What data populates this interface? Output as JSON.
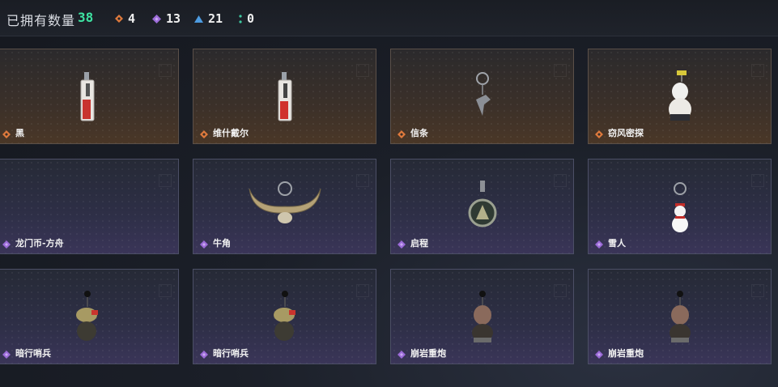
{
  "header": {
    "owned_label": "已拥有数量",
    "owned_count": "38",
    "stats": [
      {
        "icon": "orange-diamond-icon",
        "color": "#e07a3c",
        "value": "4"
      },
      {
        "icon": "purple-diamond-icon",
        "color": "#9c6bd8",
        "value": "13"
      },
      {
        "icon": "blue-triangle-icon",
        "color": "#4d9be0",
        "value": "21"
      },
      {
        "icon": "green-dots-icon",
        "color": "#3ec9a0",
        "value": "0"
      }
    ]
  },
  "colors": {
    "orange": "#e07a3c",
    "purple": "#9c6bd8"
  },
  "items": [
    {
      "name": "黑",
      "rarity": "orange",
      "icon": "lighter-charm-icon"
    },
    {
      "name": "维什戴尔",
      "rarity": "orange",
      "icon": "lighter-charm-icon"
    },
    {
      "name": "信条",
      "rarity": "orange",
      "icon": "bird-charm-icon"
    },
    {
      "name": "窃风密探",
      "rarity": "orange",
      "icon": "figure-charm-icon"
    },
    {
      "name": "龙门币-方舟",
      "rarity": "purple",
      "icon": "empty-charm-icon"
    },
    {
      "name": "牛角",
      "rarity": "purple",
      "icon": "horn-charm-icon"
    },
    {
      "name": "启程",
      "rarity": "purple",
      "icon": "medal-charm-icon"
    },
    {
      "name": "雪人",
      "rarity": "purple",
      "icon": "snowman-charm-icon"
    },
    {
      "name": "暗行哨兵",
      "rarity": "purple",
      "icon": "sentinel-charm-icon"
    },
    {
      "name": "暗行哨兵",
      "rarity": "purple",
      "icon": "sentinel-charm-icon"
    },
    {
      "name": "崩岩重炮",
      "rarity": "purple",
      "icon": "gunner-charm-icon"
    },
    {
      "name": "崩岩重炮",
      "rarity": "purple",
      "icon": "gunner-charm-icon"
    }
  ]
}
